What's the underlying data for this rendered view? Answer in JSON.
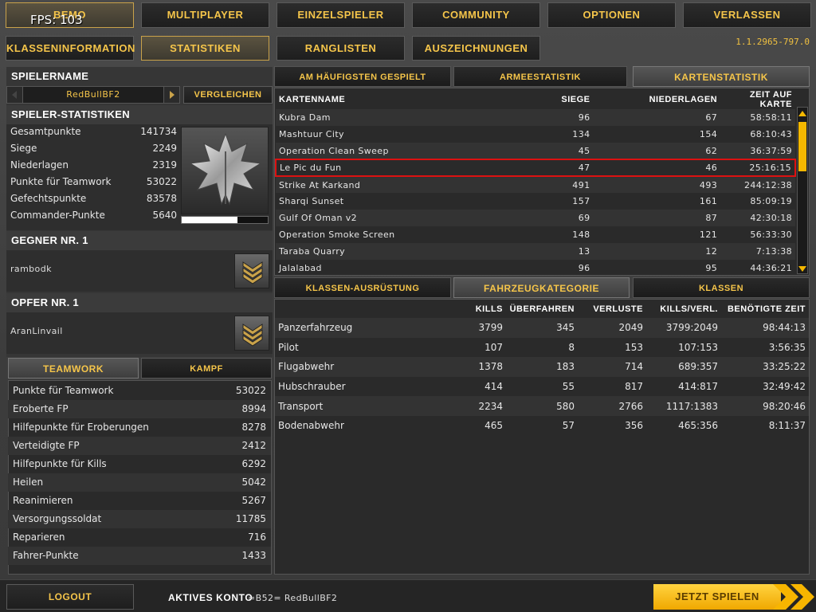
{
  "overlay": {
    "fps": "FPS: 103"
  },
  "version": "1.1.2965-797.0",
  "top_nav": [
    {
      "label": "BEMO"
    },
    {
      "label": "MULTIPLAYER"
    },
    {
      "label": "EINZELSPIELER"
    },
    {
      "label": "COMMUNITY"
    },
    {
      "label": "OPTIONEN"
    },
    {
      "label": "VERLASSEN"
    }
  ],
  "sub_nav": [
    {
      "label": "KLASSENINFORMATION"
    },
    {
      "label": "STATISTIKEN"
    },
    {
      "label": "RANGLISTEN"
    },
    {
      "label": "AUSZEICHNUNGEN"
    }
  ],
  "player": {
    "heading": "SPIELERNAME",
    "name": "RedBullBF2",
    "compare_label": "VERGLEICHEN"
  },
  "player_stats": {
    "heading": "SPIELER-STATISTIKEN",
    "rank_progress": 0.65,
    "rows": [
      {
        "label": "Gesamtpunkte",
        "value": "141734"
      },
      {
        "label": "Siege",
        "value": "2249"
      },
      {
        "label": "Niederlagen",
        "value": "2319"
      },
      {
        "label": "Punkte für Teamwork",
        "value": "53022"
      },
      {
        "label": "Gefechtspunkte",
        "value": "83578"
      },
      {
        "label": "Commander-Punkte",
        "value": "5640"
      }
    ]
  },
  "nemesis": {
    "heading": "GEGNER NR. 1",
    "name": "rambodk"
  },
  "victim": {
    "heading": "OPFER NR. 1",
    "name": "AranLinvail"
  },
  "lower_tabs": [
    {
      "label": "TEAMWORK",
      "active": true
    },
    {
      "label": "KAMPF",
      "active": false
    }
  ],
  "teamwork_rows": [
    {
      "label": "Punkte für Teamwork",
      "value": "53022"
    },
    {
      "label": "Eroberte FP",
      "value": "8994"
    },
    {
      "label": "Hilfepunkte für Eroberungen",
      "value": "8278"
    },
    {
      "label": "Verteidigte FP",
      "value": "2412"
    },
    {
      "label": "Hilfepunkte für Kills",
      "value": "6292"
    },
    {
      "label": "Heilen",
      "value": "5042"
    },
    {
      "label": "Reanimieren",
      "value": "5267"
    },
    {
      "label": "Versorgungssoldat",
      "value": "11785"
    },
    {
      "label": "Reparieren",
      "value": "716"
    },
    {
      "label": "Fahrer-Punkte",
      "value": "1433"
    }
  ],
  "map_tabs": [
    {
      "label": "AM HÄUFIGSTEN GESPIELT",
      "active": false
    },
    {
      "label": "ARMEESTATISTIK",
      "active": false
    },
    {
      "label": "KARTENSTATISTIK",
      "active": true
    }
  ],
  "map_table": {
    "headers": [
      "KARTENNAME",
      "SIEGE",
      "NIEDERLAGEN",
      "ZEIT AUF KARTE"
    ],
    "rows": [
      [
        "Kubra Dam",
        "96",
        "67",
        "58:58:11"
      ],
      [
        "Mashtuur City",
        "134",
        "154",
        "68:10:43"
      ],
      [
        "Operation Clean Sweep",
        "45",
        "62",
        "36:37:59"
      ],
      [
        "Le Pic du Fun",
        "47",
        "46",
        "25:16:15"
      ],
      [
        "Strike At Karkand",
        "491",
        "493",
        "244:12:38"
      ],
      [
        "Sharqi Sunset",
        "157",
        "161",
        "85:09:19"
      ],
      [
        "Gulf Of Oman v2",
        "69",
        "87",
        "42:30:18"
      ],
      [
        "Operation Smoke Screen",
        "148",
        "121",
        "56:33:30"
      ],
      [
        "Taraba Quarry",
        "13",
        "12",
        "7:13:38"
      ],
      [
        "Jalalabad",
        "96",
        "95",
        "44:36:21"
      ]
    ],
    "highlighted_row": 3
  },
  "vehicle_tabs": [
    {
      "label": "KLASSEN-AUSRÜSTUNG",
      "active": false
    },
    {
      "label": "FAHRZEUGKATEGORIE",
      "active": true
    },
    {
      "label": "KLASSEN",
      "active": false
    }
  ],
  "vehicle_table": {
    "headers": [
      "",
      "KILLS",
      "ÜBERFAHREN",
      "VERLUSTE",
      "KILLS/VERL.",
      "BENÖTIGTE ZEIT"
    ],
    "rows": [
      [
        "Panzerfahrzeug",
        "3799",
        "345",
        "2049",
        "3799:2049",
        "98:44:13"
      ],
      [
        "Pilot",
        "107",
        "8",
        "153",
        "107:153",
        "3:56:35"
      ],
      [
        "Flugabwehr",
        "1378",
        "183",
        "714",
        "689:357",
        "33:25:22"
      ],
      [
        "Hubschrauber",
        "414",
        "55",
        "817",
        "414:817",
        "32:49:42"
      ],
      [
        "Transport",
        "2234",
        "580",
        "2766",
        "1117:1383",
        "98:20:46"
      ],
      [
        "Bodenabwehr",
        "465",
        "57",
        "356",
        "465:356",
        "8:11:37"
      ]
    ]
  },
  "footer": {
    "logout_label": "LOGOUT",
    "account_label": "AKTIVES KONTO",
    "account_name": "=B52= RedBullBF2",
    "play_label": "JETZT SPIELEN"
  },
  "colors": {
    "accent": "#f5c54a",
    "highlight": "#dd1111",
    "play": "#f7b500"
  }
}
